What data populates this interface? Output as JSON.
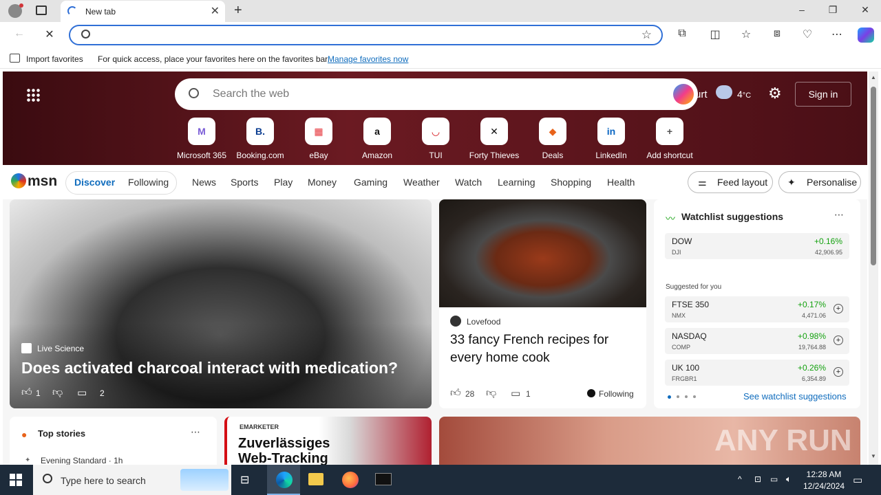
{
  "browser": {
    "tab_title": "New tab",
    "address_value": "",
    "favbar": {
      "import_label": "Import favorites",
      "hint": "For quick access, place your favorites here on the favorites bar.",
      "manage_link": "Manage favorites now"
    }
  },
  "msn": {
    "search_placeholder": "Search the web",
    "location": "urt",
    "temperature": "4",
    "temp_unit": "°C",
    "signin": "Sign in",
    "shortcuts": [
      {
        "label": "Microsoft 365",
        "glyph": "M",
        "color": "#7a5cd6"
      },
      {
        "label": "Booking.com",
        "glyph": "B.",
        "color": "#0b3d91"
      },
      {
        "label": "eBay",
        "glyph": "▦",
        "color": "#e53238"
      },
      {
        "label": "Amazon",
        "glyph": "a",
        "color": "#111"
      },
      {
        "label": "TUI",
        "glyph": "◡",
        "color": "#d40e14"
      },
      {
        "label": "Forty Thieves",
        "glyph": "✕",
        "color": "#111"
      },
      {
        "label": "Deals",
        "glyph": "◆",
        "color": "#e8631b"
      },
      {
        "label": "LinkedIn",
        "glyph": "in",
        "color": "#0a66c2"
      },
      {
        "label": "Add shortcut",
        "glyph": "+",
        "color": "#555"
      }
    ],
    "logo": "msn",
    "pills": [
      "Discover",
      "Following"
    ],
    "nav": [
      "News",
      "Sports",
      "Play",
      "Money",
      "Gaming",
      "Weather",
      "Watch",
      "Learning",
      "Shopping",
      "Health"
    ],
    "feed_layout": "Feed layout",
    "personalise": "Personalise",
    "hero_card": {
      "source": "Live Science",
      "title": "Does activated charcoal interact with medication?",
      "likes": "1",
      "comments": "2"
    },
    "food_card": {
      "source": "Lovefood",
      "title": "33 fancy French recipes for every home cook",
      "likes": "28",
      "comments": "1",
      "following": "Following"
    },
    "watchlist": {
      "title": "Watchlist suggestions",
      "main": {
        "name": "DOW",
        "sub": "DJI",
        "change": "+0.16%",
        "value": "42,906.95"
      },
      "suggested_label": "Suggested for you",
      "items": [
        {
          "name": "FTSE 350",
          "sub": "NMX",
          "change": "+0.17%",
          "value": "4,471.06"
        },
        {
          "name": "NASDAQ",
          "sub": "COMP",
          "change": "+0.98%",
          "value": "19,764.88"
        },
        {
          "name": "UK 100",
          "sub": "FRGBR1",
          "change": "+0.26%",
          "value": "6,354.89"
        }
      ],
      "see_more": "See watchlist suggestions"
    },
    "top_stories": {
      "title": "Top stories",
      "source": "Evening Standard · 1h"
    },
    "ad": {
      "brand": "EMARKETER",
      "line1": "Zuverlässiges",
      "line2": "Web-Tracking"
    },
    "watermark": "ANY RUN"
  },
  "taskbar": {
    "search_placeholder": "Type here to search",
    "time": "12:28 AM",
    "date": "12/24/2024"
  },
  "colors": {
    "accent": "#0f6cbd",
    "positive": "#13a10e",
    "hero_bg": "#5a1219"
  }
}
